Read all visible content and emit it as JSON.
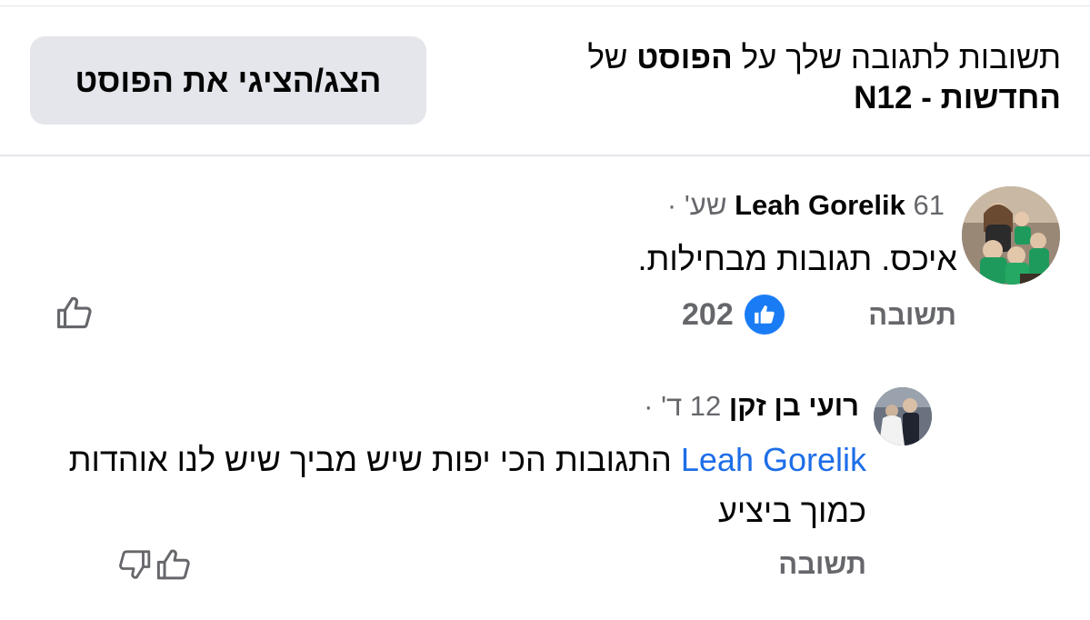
{
  "header": {
    "title_prefix": "תשובות לתגובה שלך על ",
    "title_bold": "הפוסט",
    "title_middle": " של ",
    "title_page": "החדשות - N12",
    "show_post_label": "הצג/הציגי את הפוסט"
  },
  "comments": [
    {
      "author": "Leah Gorelik",
      "time": "61 שע'",
      "separator": "·",
      "text": "איכס. תגובות מבחילות.",
      "reply_label": "תשובה",
      "reactions": {
        "count": "202",
        "type": "like-icon"
      }
    },
    {
      "author": "רועי בן זקן",
      "time": "12 ד'",
      "separator": "·",
      "mention": "Leah Gorelik",
      "text": " התגובות הכי יפות שיש מביך שיש לנו אוהדות כמוך ביציע",
      "reply_label": "תשובה"
    }
  ],
  "colors": {
    "button_bg": "#e4e6eb",
    "secondary_text": "#65676b",
    "mention": "#1d6ee8",
    "like_badge": "#1a7cf5"
  }
}
